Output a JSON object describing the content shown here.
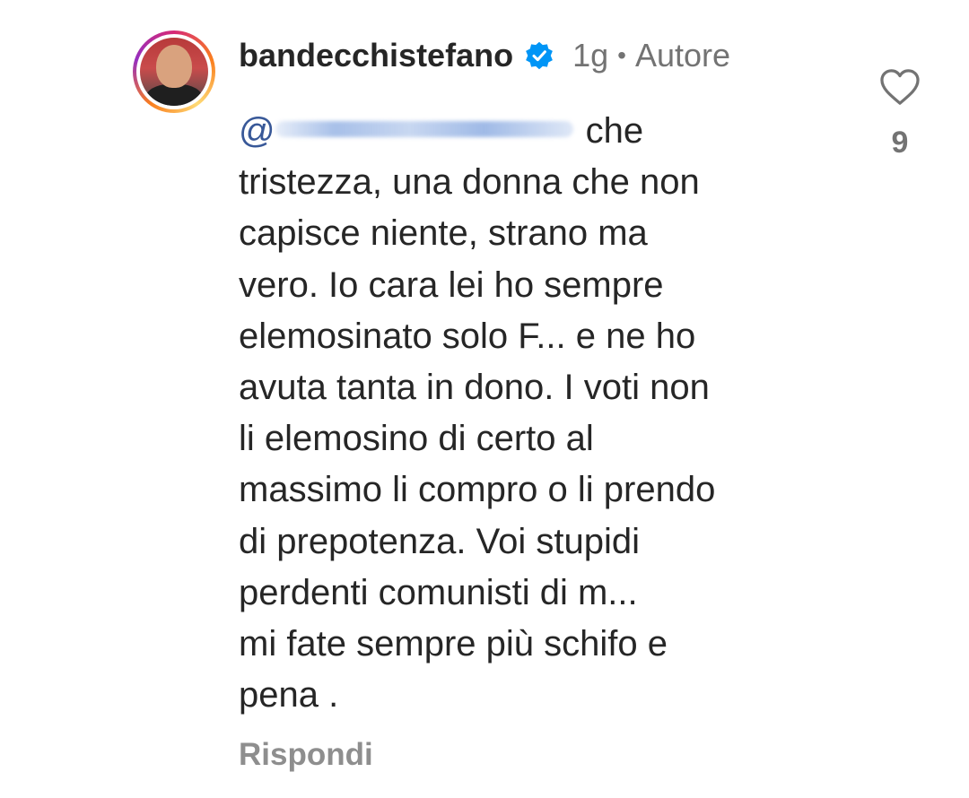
{
  "comment": {
    "username": "bandecchistefano",
    "verified_icon": "verified-badge-icon",
    "time": "1g",
    "separator": "•",
    "author_label": "Autore",
    "mention_prefix": "@",
    "body_lines": [
      "che",
      "tristezza, una donna che non",
      "capisce niente, strano ma",
      "vero. Io cara lei ho sempre",
      "elemosinato solo F... e ne ho",
      "avuta tanta in dono. I voti non",
      "li elemosino di certo al",
      "massimo li compro o li prendo",
      "di prepotenza. Voi stupidi",
      "perdenti comunisti di m...",
      "mi fate sempre più schifo e",
      "pena ."
    ],
    "reply_label": "Rispondi",
    "like_icon": "heart-icon",
    "like_count": "9"
  },
  "colors": {
    "text": "#262626",
    "secondary": "#737373",
    "mention": "#385898",
    "verified": "#0095f6"
  }
}
